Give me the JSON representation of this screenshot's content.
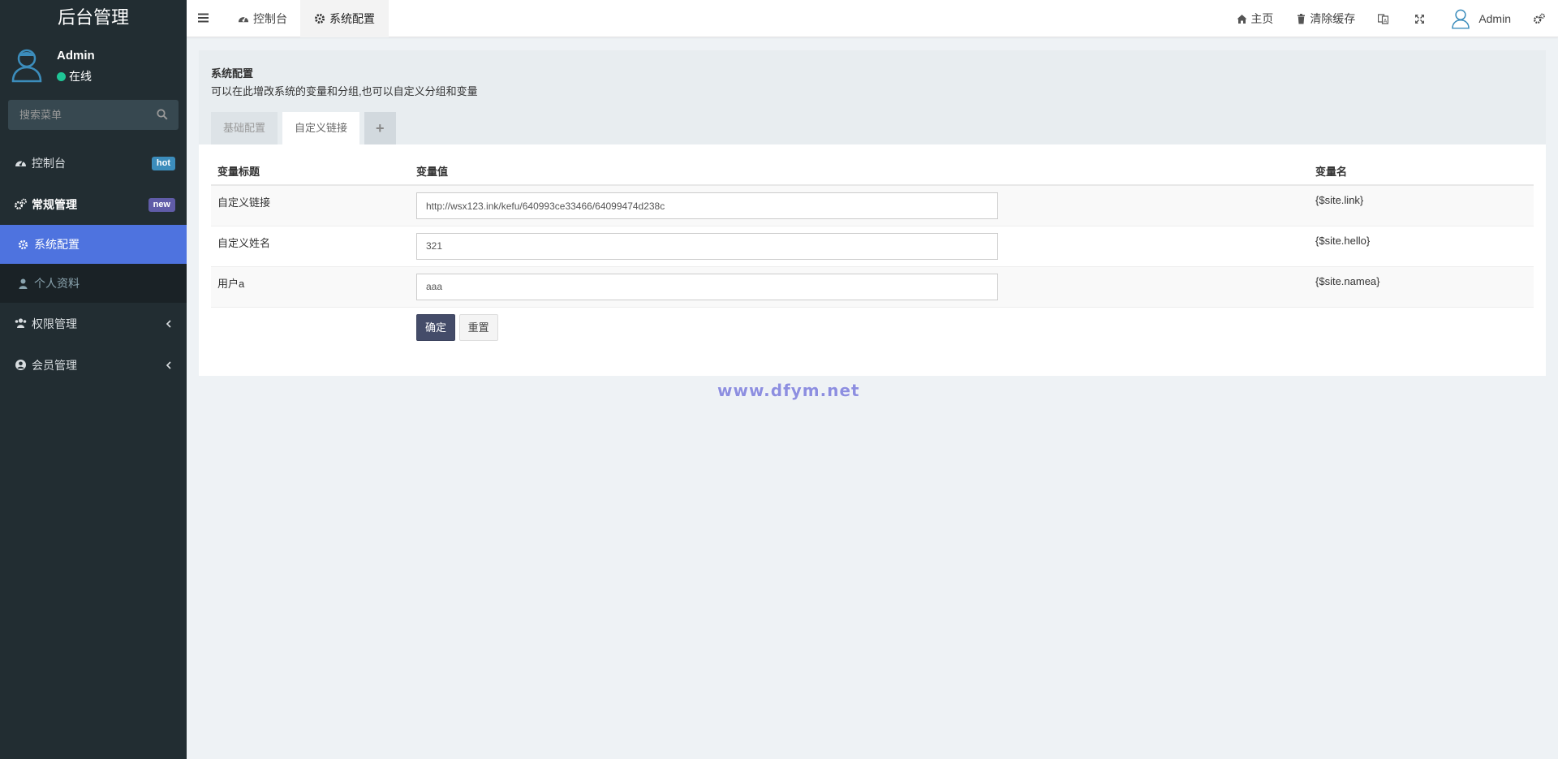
{
  "brand": {
    "title": "后台管理"
  },
  "user": {
    "name": "Admin",
    "status": "在线"
  },
  "search": {
    "placeholder": "搜索菜单"
  },
  "sidebar": {
    "items": [
      {
        "label": "控制台",
        "icon": "dashboard-icon",
        "badge": "hot"
      },
      {
        "label": "常规管理",
        "icon": "cogs-icon",
        "badge": "new"
      },
      {
        "label": "权限管理",
        "icon": "users-icon"
      },
      {
        "label": "会员管理",
        "icon": "user-circle-icon"
      }
    ],
    "submenu": [
      {
        "label": "系统配置",
        "icon": "gear-icon"
      },
      {
        "label": "个人资料",
        "icon": "user-icon"
      }
    ]
  },
  "header": {
    "tabs": [
      {
        "label": "控制台",
        "icon": "dashboard-icon"
      },
      {
        "label": "系统配置",
        "icon": "gear-icon"
      }
    ],
    "home": "主页",
    "clear_cache": "清除缓存",
    "user": "Admin"
  },
  "panel": {
    "title": "系统配置",
    "desc": "可以在此增改系统的变量和分组,也可以自定义分组和变量",
    "tabs": [
      "基础配置",
      "自定义链接",
      "+"
    ]
  },
  "table": {
    "headers": [
      "变量标题",
      "变量值",
      "变量名"
    ],
    "rows": [
      {
        "title": "自定义链接",
        "value": "http://wsx123.ink/kefu/640993ce33466/64099474d238c",
        "name": "{$site.link}"
      },
      {
        "title": "自定义姓名",
        "value": "321",
        "name": "{$site.hello}"
      },
      {
        "title": "用户a",
        "value": "aaa",
        "name": "{$site.namea}"
      }
    ]
  },
  "buttons": {
    "ok": "确定",
    "reset": "重置"
  },
  "watermark": "www.dfym.net",
  "colors": {
    "sidebar": "#222d32",
    "active": "#4e73df",
    "hot": "#3c8dbc",
    "new": "#605ca8",
    "online": "#1fc596"
  }
}
